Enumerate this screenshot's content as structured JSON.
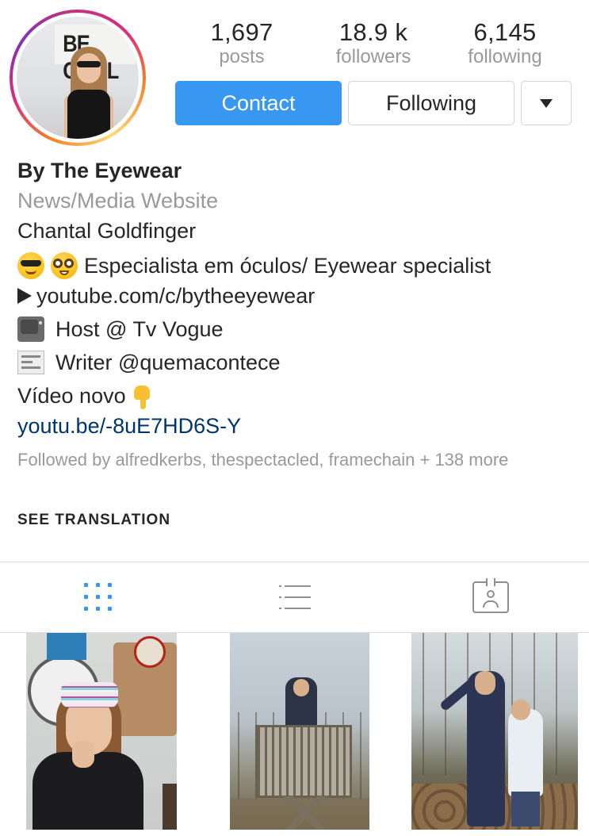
{
  "profile": {
    "stats": [
      {
        "value": "1,697",
        "label": "posts"
      },
      {
        "value": "18.9 k",
        "label": "followers"
      },
      {
        "value": "6,145",
        "label": "following"
      }
    ],
    "buttons": {
      "contact": "Contact",
      "following": "Following"
    }
  },
  "bio": {
    "name": "By The Eyewear",
    "category": "News/Media Website",
    "real_name": "Chantal Goldfinger",
    "line_specialist": "Especialista em óculos/ Eyewear specialist",
    "line_youtube": "youtube.com/c/bytheeyewear",
    "line_host": "Host @ Tv Vogue",
    "line_writer": "Writer @quemacontece",
    "line_video": "Vídeo novo",
    "link": "youtu.be/-8uE7HD6S-Y",
    "followed_by": "Followed by alfredkerbs, thespectacled, framechain + 138 more",
    "see_translation": "SEE TRANSLATION"
  },
  "avatar_sign_text": "BE COOL",
  "tabs": [
    {
      "icon": "grid-icon",
      "active": true
    },
    {
      "icon": "list-icon",
      "active": false
    },
    {
      "icon": "tagged-icon",
      "active": false
    }
  ],
  "colors": {
    "accent_blue": "#3897f0",
    "link_blue": "#003569",
    "secondary_text": "#999999"
  }
}
